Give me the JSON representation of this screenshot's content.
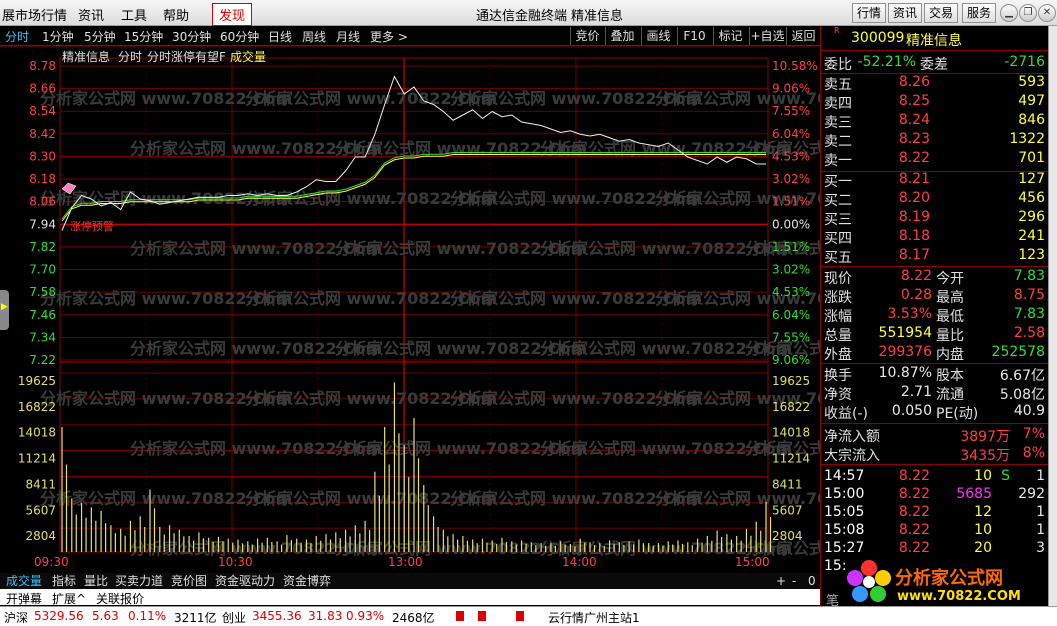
{
  "menu": {
    "items": [
      "展市场行情",
      "资讯",
      "工具",
      "帮助",
      "发现"
    ],
    "center": [
      "通达信金融终端",
      "精准信息"
    ],
    "right_buttons": [
      "行情",
      "资讯",
      "交易",
      "服务"
    ]
  },
  "period_tabs": [
    "分时",
    "1分钟",
    "5分钟",
    "15分钟",
    "30分钟",
    "60分钟",
    "日线",
    "周线",
    "月线",
    "更多 >"
  ],
  "tool_buttons": [
    "竞价",
    "叠加",
    "画线",
    "F10",
    "标记",
    "+自选",
    "返回"
  ],
  "chart_header": {
    "name": "精准信息",
    "p1": "分时",
    "p2": "分时涨停有望F",
    "p3": "成交量",
    "marker": "涨停预警"
  },
  "watermark": "分析家公式网 www.70822.Com",
  "price_labels": [
    "8.78",
    "8.66",
    "8.54",
    "8.42",
    "8.30",
    "8.18",
    "8.06",
    "7.94",
    "7.82",
    "7.70",
    "7.58",
    "7.46",
    "7.34",
    "7.22"
  ],
  "pct_labels": [
    "10.58%",
    "9.06%",
    "7.55%",
    "6.04%",
    "4.53%",
    "3.02%",
    "1.51%",
    "0.00%",
    "1.51%",
    "3.02%",
    "4.53%",
    "6.04%",
    "7.55%",
    "9.06%"
  ],
  "vol_labels": [
    "19625",
    "16822",
    "14018",
    "11214",
    "8411",
    "5607",
    "2804"
  ],
  "time_labels": [
    "09:30",
    "10:30",
    "13:00",
    "14:00",
    "15:00"
  ],
  "chart_data": {
    "type": "line",
    "title": "精准信息 分时",
    "prev_close": 7.94,
    "ylim": [
      7.1,
      8.78
    ],
    "price": [
      7.84,
      7.97,
      8.04,
      8.02,
      7.98,
      8.0,
      7.96,
      8.06,
      8.02,
      8.01,
      7.99,
      8.0,
      8.01,
      8.02,
      8.03,
      8.03,
      8.03,
      8.04,
      8.04,
      8.05,
      8.04,
      8.05,
      8.04,
      8.04,
      8.06,
      8.09,
      8.13,
      8.12,
      8.12,
      8.18,
      8.26,
      8.26,
      8.39,
      8.56,
      8.72,
      8.62,
      8.66,
      8.58,
      8.56,
      8.52,
      8.47,
      8.5,
      8.53,
      8.48,
      8.52,
      8.49,
      8.5,
      8.46,
      8.45,
      8.44,
      8.42,
      8.4,
      8.41,
      8.39,
      8.38,
      8.39,
      8.37,
      8.35,
      8.36,
      8.34,
      8.33,
      8.32,
      8.34,
      8.3,
      8.26,
      8.24,
      8.22,
      8.26,
      8.23,
      8.26,
      8.25,
      8.22,
      8.22
    ],
    "avg": [
      7.9,
      7.97,
      7.99,
      7.99,
      8.0,
      8.0,
      8.0,
      8.01,
      8.01,
      8.01,
      8.01,
      8.01,
      8.01,
      8.01,
      8.02,
      8.02,
      8.02,
      8.02,
      8.02,
      8.03,
      8.03,
      8.03,
      8.03,
      8.03,
      8.03,
      8.04,
      8.05,
      8.06,
      8.06,
      8.07,
      8.09,
      8.11,
      8.15,
      8.22,
      8.25,
      8.26,
      8.26,
      8.27,
      8.27,
      8.27,
      8.28,
      8.28,
      8.28,
      8.28,
      8.28,
      8.28,
      8.28,
      8.28,
      8.28,
      8.28,
      8.28,
      8.28,
      8.28,
      8.28,
      8.28,
      8.28,
      8.28,
      8.28,
      8.28,
      8.28,
      8.28,
      8.28,
      8.28,
      8.28,
      8.28,
      8.28,
      8.28,
      8.28,
      8.28,
      8.28,
      8.28,
      8.28,
      8.28
    ],
    "volume": [
      14000,
      6000,
      5500,
      5000,
      4600,
      3000,
      2600,
      3500,
      4000,
      7000,
      2800,
      3000,
      2500,
      1800,
      2200,
      1600,
      1700,
      1500,
      1400,
      1200,
      1500,
      1600,
      1200,
      1900,
      1500,
      1400,
      1800,
      2000,
      2200,
      2500,
      3000,
      3500,
      9000,
      14000,
      19000,
      12000,
      15000,
      7500,
      4000,
      2500,
      2000,
      1800,
      1400,
      1500,
      1300,
      1600,
      1200,
      1300,
      1100,
      1000,
      1000,
      1200,
      900,
      1500,
      1100,
      1000,
      1300,
      1100,
      1200,
      1400,
      1000,
      1000,
      1200,
      1300,
      1100,
      1500,
      1800,
      2400,
      2000,
      1800,
      2600,
      3400,
      5600
    ]
  },
  "right": {
    "code": "300099",
    "name": "精准信息",
    "wb_label": "委比",
    "wb": "-52.21%",
    "wc_label": "委差",
    "wc": "-2716",
    "asks": [
      {
        "l": "卖五",
        "p": "8.26",
        "v": "593"
      },
      {
        "l": "卖四",
        "p": "8.25",
        "v": "497"
      },
      {
        "l": "卖三",
        "p": "8.24",
        "v": "846"
      },
      {
        "l": "卖二",
        "p": "8.23",
        "v": "1322"
      },
      {
        "l": "卖一",
        "p": "8.22",
        "v": "701"
      }
    ],
    "bids": [
      {
        "l": "买一",
        "p": "8.21",
        "v": "127"
      },
      {
        "l": "买二",
        "p": "8.20",
        "v": "456"
      },
      {
        "l": "买三",
        "p": "8.19",
        "v": "296"
      },
      {
        "l": "买四",
        "p": "8.18",
        "v": "241"
      },
      {
        "l": "买五",
        "p": "8.17",
        "v": "123"
      }
    ],
    "stats": [
      {
        "l1": "现价",
        "v1": "8.22",
        "c1": "red",
        "l2": "今开",
        "v2": "7.83",
        "c2": "grn"
      },
      {
        "l1": "涨跌",
        "v1": "0.28",
        "c1": "red",
        "l2": "最高",
        "v2": "8.75",
        "c2": "red"
      },
      {
        "l1": "涨幅",
        "v1": "3.53%",
        "c1": "red",
        "l2": "最低",
        "v2": "7.83",
        "c2": "grn"
      },
      {
        "l1": "总量",
        "v1": "551954",
        "c1": "yel",
        "l2": "量比",
        "v2": "2.58",
        "c2": "red"
      },
      {
        "l1": "外盘",
        "v1": "299376",
        "c1": "red",
        "l2": "内盘",
        "v2": "252578",
        "c2": "grn"
      }
    ],
    "stats2": [
      {
        "l1": "换手",
        "v1": "10.87%",
        "l2": "股本",
        "v2": "6.67亿"
      },
      {
        "l1": "净资",
        "v1": "2.71",
        "l2": "流通",
        "v2": "5.08亿"
      },
      {
        "l1": "收益(-)",
        "v1": "0.050",
        "l2": "PE(动)",
        "v2": "40.9"
      }
    ],
    "flows": [
      {
        "l": "净流入额",
        "v": "3897万",
        "p": "7%"
      },
      {
        "l": "大宗流入",
        "v": "3435万",
        "p": "8%"
      }
    ],
    "ticks": [
      {
        "t": "14:57",
        "p": "8.22",
        "v": "10",
        "c": "S",
        "n": "1"
      },
      {
        "t": "15:00",
        "p": "8.22",
        "v": "5685",
        "c": "",
        "n": "292"
      },
      {
        "t": "15:05",
        "p": "8.22",
        "v": "12",
        "c": "",
        "n": "1"
      },
      {
        "t": "15:08",
        "p": "8.22",
        "v": "10",
        "c": "",
        "n": "1"
      },
      {
        "t": "15:27",
        "p": "8.22",
        "v": "20",
        "c": "",
        "n": "3"
      },
      {
        "t": "15:",
        "p": "",
        "v": "",
        "c": "",
        "n": ""
      }
    ]
  },
  "bottom_tabs": [
    "成交量",
    "指标",
    "量比",
    "买卖力道",
    "竞价图",
    "资金驱动力",
    "资金博弈"
  ],
  "bottom_right": [
    "+",
    "-",
    "0"
  ],
  "bottom2": [
    "开弹幕",
    "扩展^",
    "关联报价"
  ],
  "status": {
    "items": [
      "沪深",
      "5329.56",
      "5.63",
      "0.11%",
      "3211亿",
      "创业",
      "3455.36",
      "31.83",
      "0.93%",
      "2468亿"
    ],
    "ticker": "云行情广州主站1"
  },
  "logo": {
    "line1": "分析家公式网",
    "line2": "www.70822.COM"
  },
  "side_tab": "笔"
}
